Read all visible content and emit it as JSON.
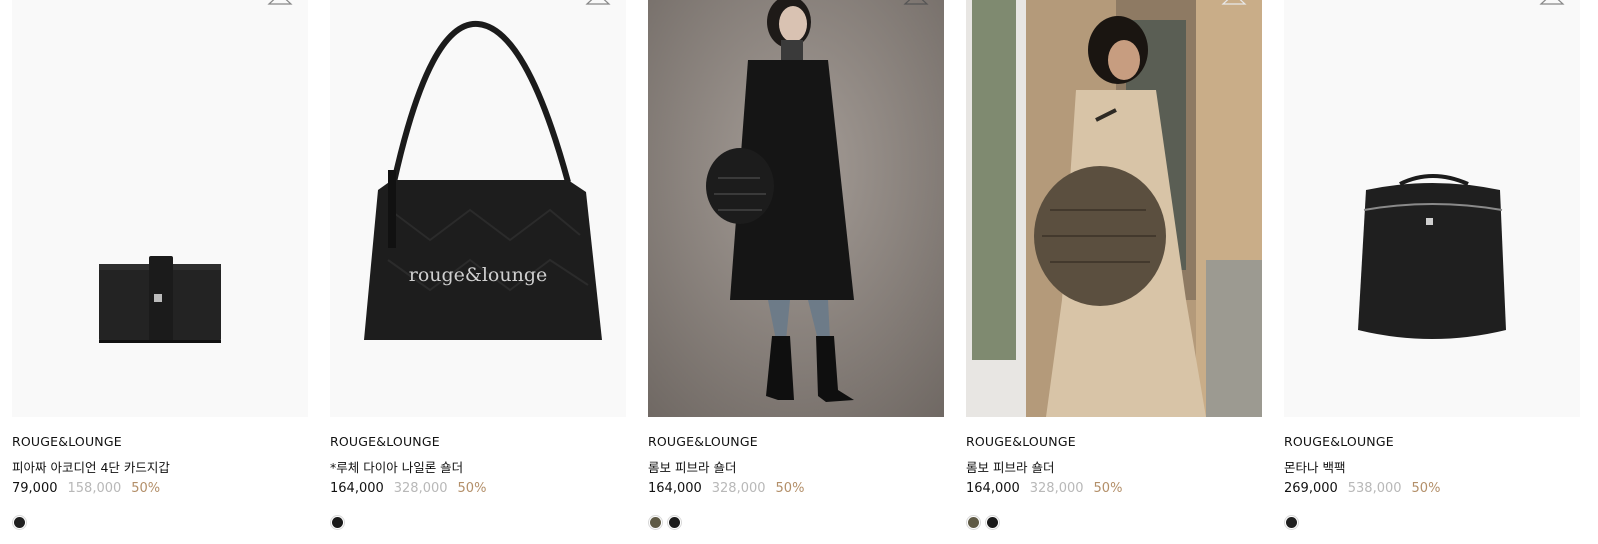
{
  "products": [
    {
      "brand": "ROUGE&LOUNGE",
      "name": "피아짜 아코디언 4단 카드지갑",
      "sale_price": "79,000",
      "original_price": "158,000",
      "discount": "50%",
      "swatches": [
        "#1f1f1f"
      ]
    },
    {
      "brand": "ROUGE&LOUNGE",
      "name": "*루체 다이아 나일론 숄더",
      "sale_price": "164,000",
      "original_price": "328,000",
      "discount": "50%",
      "swatches": [
        "#1a1a1a"
      ],
      "print_text": "rouge&lounge"
    },
    {
      "brand": "ROUGE&LOUNGE",
      "name": "롬보 피브라 숄더",
      "sale_price": "164,000",
      "original_price": "328,000",
      "discount": "50%",
      "swatches": [
        "#5f5a45",
        "#1a1a1a"
      ]
    },
    {
      "brand": "ROUGE&LOUNGE",
      "name": "롬보 피브라 숄더",
      "sale_price": "164,000",
      "original_price": "328,000",
      "discount": "50%",
      "swatches": [
        "#5f5a45",
        "#1a1a1a"
      ]
    },
    {
      "brand": "ROUGE&LOUNGE",
      "name": "몬타나 백팩",
      "sale_price": "269,000",
      "original_price": "538,000",
      "discount": "50%",
      "swatches": [
        "#1f1f1f"
      ]
    }
  ],
  "colors": {
    "discount": "#b38f69",
    "original_price": "#b8b8b8",
    "image_bg": "#f9f9f9"
  },
  "icons": {
    "wishlist": "hanger-icon"
  }
}
